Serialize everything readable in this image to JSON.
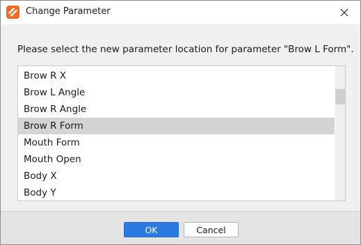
{
  "window": {
    "title": "Change Parameter",
    "app_icon": "cubism-logo-icon",
    "close_icon": "close-icon"
  },
  "message": "Please select the new parameter location for parameter \"Brow L Form\".",
  "list": {
    "items": [
      {
        "label": "Brow R X",
        "selected": false
      },
      {
        "label": "Brow L Angle",
        "selected": false
      },
      {
        "label": "Brow R Angle",
        "selected": false
      },
      {
        "label": "Brow R Form",
        "selected": true
      },
      {
        "label": "Mouth Form",
        "selected": false
      },
      {
        "label": "Mouth Open",
        "selected": false
      },
      {
        "label": "Body X",
        "selected": false
      },
      {
        "label": "Body Y",
        "selected": false
      }
    ],
    "selected_color": "#d4d4d4"
  },
  "buttons": {
    "ok_label": "OK",
    "cancel_label": "Cancel"
  },
  "colors": {
    "accent": "#2b7ae4",
    "app_icon": "#f26a1b"
  }
}
